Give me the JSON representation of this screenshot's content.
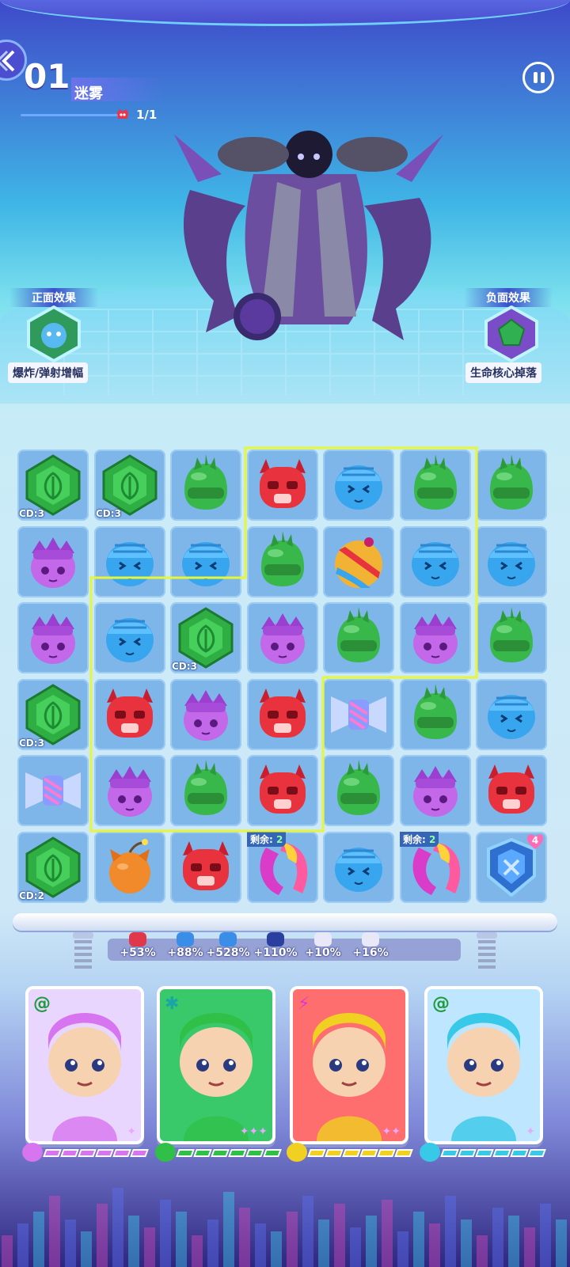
{
  "hud": {
    "level_number": "01",
    "level_name": "迷雾",
    "wave_count": "1/1"
  },
  "effects": {
    "positive_title": "正面效果",
    "positive_label": "爆炸/弹射增幅",
    "negative_title": "负面效果",
    "negative_label": "生命核心掉落"
  },
  "board": {
    "rows": [
      [
        {
          "p": "gem",
          "cd": "CD:3"
        },
        {
          "p": "gem",
          "cd": "CD:3"
        },
        {
          "p": "green"
        },
        {
          "p": "red"
        },
        {
          "p": "blue"
        },
        {
          "p": "green"
        },
        {
          "p": "green"
        }
      ],
      [
        {
          "p": "purple"
        },
        {
          "p": "blue"
        },
        {
          "p": "blue"
        },
        {
          "p": "green"
        },
        {
          "p": "ball"
        },
        {
          "p": "blue"
        },
        {
          "p": "blue"
        }
      ],
      [
        {
          "p": "purple"
        },
        {
          "p": "blue"
        },
        {
          "p": "gem",
          "cd": "CD:3"
        },
        {
          "p": "purple"
        },
        {
          "p": "green"
        },
        {
          "p": "purple"
        },
        {
          "p": "green"
        }
      ],
      [
        {
          "p": "gem",
          "cd": "CD:3"
        },
        {
          "p": "red"
        },
        {
          "p": "purple"
        },
        {
          "p": "red"
        },
        {
          "p": "candy"
        },
        {
          "p": "green"
        },
        {
          "p": "blue"
        }
      ],
      [
        {
          "p": "candy"
        },
        {
          "p": "purple"
        },
        {
          "p": "green"
        },
        {
          "p": "red"
        },
        {
          "p": "green"
        },
        {
          "p": "purple"
        },
        {
          "p": "red"
        }
      ],
      [
        {
          "p": "gem",
          "cd": "CD:2"
        },
        {
          "p": "bomb"
        },
        {
          "p": "red"
        },
        {
          "p": "boomerang",
          "remain_label": "剩余:",
          "remain": "2"
        },
        {
          "p": "blue"
        },
        {
          "p": "boomerang",
          "remain_label": "剩余:",
          "remain": "2"
        },
        {
          "p": "shield",
          "hearts": "4"
        }
      ]
    ]
  },
  "buffs": [
    {
      "icon": "bomb-buff-icon",
      "value": "+53%",
      "color": "#e0384a"
    },
    {
      "icon": "blue-buff-icon",
      "value": "+88%",
      "color": "#3a8ee8"
    },
    {
      "icon": "blue-buff-icon",
      "value": "+528%",
      "color": "#3a8ee8"
    },
    {
      "icon": "shield-buff-icon",
      "value": "+110%",
      "color": "#2a3fa0"
    },
    {
      "icon": "spike-buff-icon",
      "value": "+10%",
      "color": "#e8e8f8"
    },
    {
      "icon": "spike-buff-icon",
      "value": "+16%",
      "color": "#e8e8f8"
    }
  ],
  "heroes": [
    {
      "name": "opera-hero",
      "badge": "@",
      "badge_color": "#1e9c3a",
      "bg": "#e9d6ff",
      "energy_color": "#d774f0",
      "stars": "✦"
    },
    {
      "name": "robot-hero",
      "badge": "✱",
      "badge_color": "#1aa6a6",
      "bg": "#39c86a",
      "energy_color": "#30c048",
      "stars": "✦✦✦"
    },
    {
      "name": "caveman-hero",
      "badge": "⚡",
      "badge_color": "#d53cd0",
      "bg": "#ff6e6e",
      "energy_color": "#f0d020",
      "stars": "✦✦"
    },
    {
      "name": "maid-hero",
      "badge": "@",
      "badge_color": "#1e9c3a",
      "bg": "#bfe6ff",
      "energy_color": "#38c8e8",
      "stars": "✦"
    }
  ]
}
